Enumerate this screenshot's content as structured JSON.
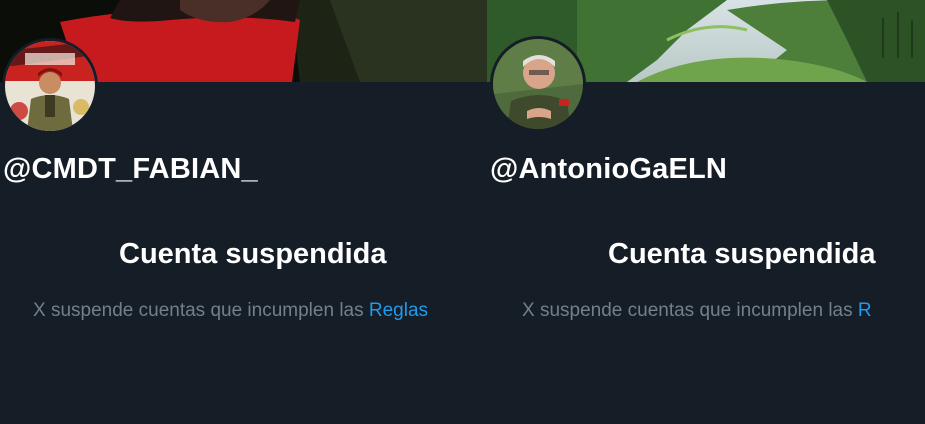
{
  "profiles": [
    {
      "handle": "@CMDT_FABIAN_",
      "suspension_title": "Cuenta suspendida",
      "suspension_message": "X suspende cuentas que incumplen las",
      "rules_link_text": "Reglas"
    },
    {
      "handle": "@AntonioGaELN",
      "suspension_title": "Cuenta suspendida",
      "suspension_message": "X suspende cuentas que incumplen las",
      "rules_link_text": "R"
    }
  ],
  "colors": {
    "background": "#151d26",
    "text_primary": "#ffffff",
    "text_secondary": "#71808c",
    "link": "#1d9bf0"
  }
}
